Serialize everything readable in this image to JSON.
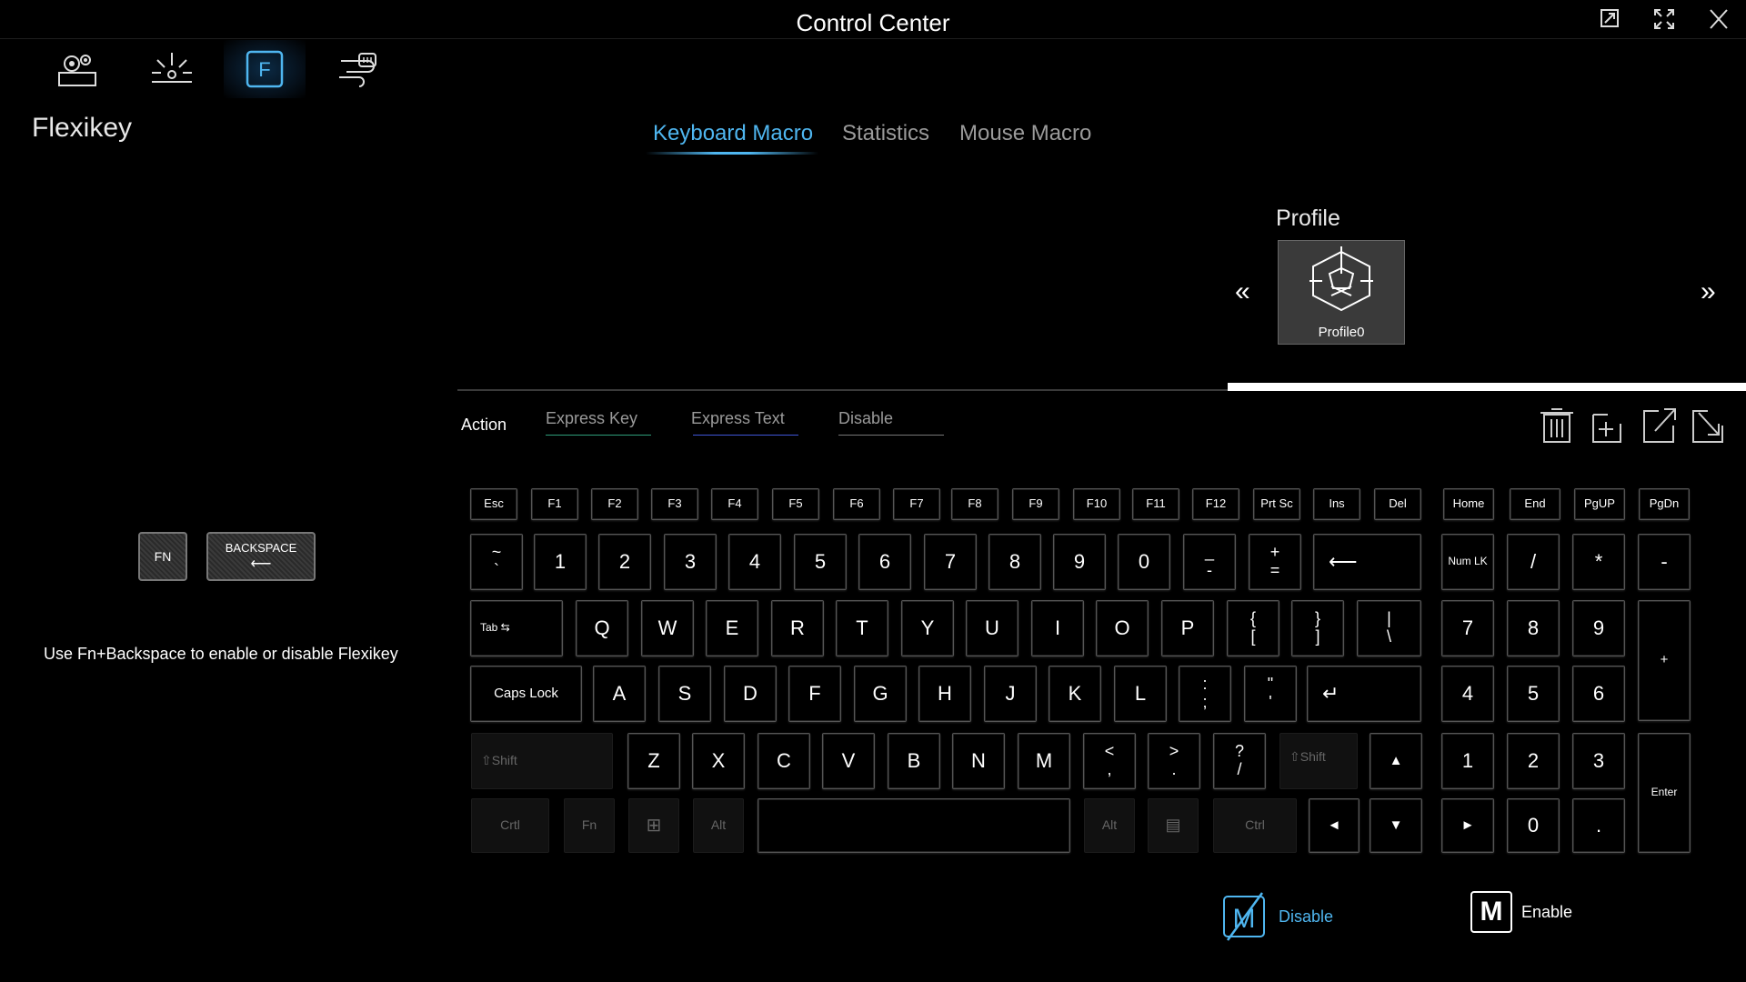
{
  "window": {
    "title": "Control Center"
  },
  "nav": [
    {
      "name": "settings-nav-icon"
    },
    {
      "name": "lighting-nav-icon"
    },
    {
      "name": "flexikey-nav-icon"
    },
    {
      "name": "fan-nav-icon"
    }
  ],
  "page": {
    "title": "Flexikey"
  },
  "tabs": {
    "keyboard_macro": "Keyboard Macro",
    "statistics": "Statistics",
    "mouse_macro": "Mouse Macro",
    "active": "Keyboard Macro"
  },
  "profile": {
    "label": "Profile",
    "name": "Profile0",
    "prev": "«",
    "next": "»"
  },
  "action": {
    "label": "Action",
    "express_key": "Express Key",
    "express_text": "Express Text",
    "disable": "Disable"
  },
  "hint": {
    "fn_key": "FN",
    "backspace_key": "BACKSPACE",
    "backspace_arrow": "⟵",
    "text": "Use Fn+Backspace to enable or disable Flexikey"
  },
  "keys": {
    "row0": [
      "Esc",
      "F1",
      "F2",
      "F3",
      "F4",
      "F5",
      "F6",
      "F7",
      "F8",
      "F9",
      "F10",
      "F11",
      "F12",
      "Prt Sc",
      "Ins",
      "Del",
      "Home",
      "End",
      "PgUP",
      "PgDn"
    ],
    "row1": [
      "1",
      "2",
      "3",
      "4",
      "5",
      "6",
      "7",
      "8",
      "9",
      "0"
    ],
    "backtick": [
      "~",
      "`"
    ],
    "minus": [
      "_",
      "-"
    ],
    "equal": [
      "+",
      "="
    ],
    "backspace": "⟵",
    "numlk": "Num LK",
    "num_div": "/",
    "num_mul": "*",
    "num_sub": "-",
    "tab": "Tab ⇆",
    "row2": [
      "Q",
      "W",
      "E",
      "R",
      "T",
      "Y",
      "U",
      "I",
      "O",
      "P"
    ],
    "lbracket": [
      "{",
      "["
    ],
    "rbracket": [
      "}",
      "]"
    ],
    "backslash": [
      "|",
      "\\"
    ],
    "num7": "7",
    "num8": "8",
    "num9": "9",
    "num_add": "+",
    "capslock": "Caps Lock",
    "row3": [
      "A",
      "S",
      "D",
      "F",
      "G",
      "H",
      "J",
      "K",
      "L"
    ],
    "semicolon": [
      ":",
      ";"
    ],
    "quote": [
      "\"",
      "'"
    ],
    "enter": "↵",
    "num4": "4",
    "num5": "5",
    "num6": "6",
    "lshift": "⇧Shift",
    "row4": [
      "Z",
      "X",
      "C",
      "V",
      "B",
      "N",
      "M"
    ],
    "comma": [
      "<",
      ","
    ],
    "period": [
      ">",
      "."
    ],
    "slash": [
      "?",
      "/"
    ],
    "rshift": "⇧Shift",
    "up": "▲",
    "num1": "1",
    "num2": "2",
    "num3": "3",
    "num_enter": "Enter",
    "lctrl": "Crtl",
    "fn": "Fn",
    "win": "⊞",
    "lalt": "Alt",
    "space": "",
    "ralt": "Alt",
    "menu": "▤",
    "rctrl": "Ctrl",
    "left": "◄",
    "down": "▼",
    "right": "►",
    "num0": "0",
    "num_dot": "."
  },
  "legend": {
    "disable": "Disable",
    "enable": "Enable",
    "enable_icon": "M"
  },
  "colors": {
    "accent": "#4fb6f0",
    "background": "#000000",
    "key_border": "#555555"
  }
}
